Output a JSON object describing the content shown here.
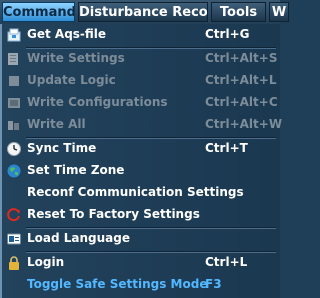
{
  "menubar": {
    "items": [
      {
        "label": "Commands"
      },
      {
        "label": "Disturbance Recorder"
      },
      {
        "label": "Tools"
      },
      {
        "label": "W"
      }
    ]
  },
  "menu": {
    "items": [
      {
        "label": "Get Aqs-file",
        "shortcut": "Ctrl+G",
        "icon": "get-file-icon",
        "enabled": true
      },
      {
        "label": "Write Settings",
        "shortcut": "Ctrl+Alt+S",
        "icon": "write-settings-icon",
        "enabled": false
      },
      {
        "label": "Update Logic",
        "shortcut": "Ctrl+Alt+L",
        "icon": "update-logic-icon",
        "enabled": false
      },
      {
        "label": "Write Configurations",
        "shortcut": "Ctrl+Alt+C",
        "icon": "write-configurations-icon",
        "enabled": false
      },
      {
        "label": "Write All",
        "shortcut": "Ctrl+Alt+W",
        "icon": "write-all-icon",
        "enabled": false
      },
      {
        "label": "Sync Time",
        "shortcut": "Ctrl+T",
        "icon": "clock-icon",
        "enabled": true
      },
      {
        "label": "Set Time Zone",
        "shortcut": "",
        "icon": "globe-icon",
        "enabled": true
      },
      {
        "label": "Reconf Communication Settings",
        "shortcut": "",
        "icon": "",
        "enabled": true
      },
      {
        "label": "Reset To Factory Settings",
        "shortcut": "",
        "icon": "reset-icon",
        "enabled": true
      },
      {
        "label": "Load Language",
        "shortcut": "",
        "icon": "language-icon",
        "enabled": true
      },
      {
        "label": "Login",
        "shortcut": "Ctrl+L",
        "icon": "lock-icon",
        "enabled": true
      },
      {
        "label": "Toggle Safe Settings Mode",
        "shortcut": "F3",
        "icon": "",
        "enabled": true,
        "highlighted": true
      }
    ]
  },
  "colors": {
    "background": "#1f3f58",
    "text": "#ffffff",
    "disabled_text": "#7d8c99",
    "highlight_text": "#53b8ff",
    "active_tab": "#2f8ed6"
  }
}
